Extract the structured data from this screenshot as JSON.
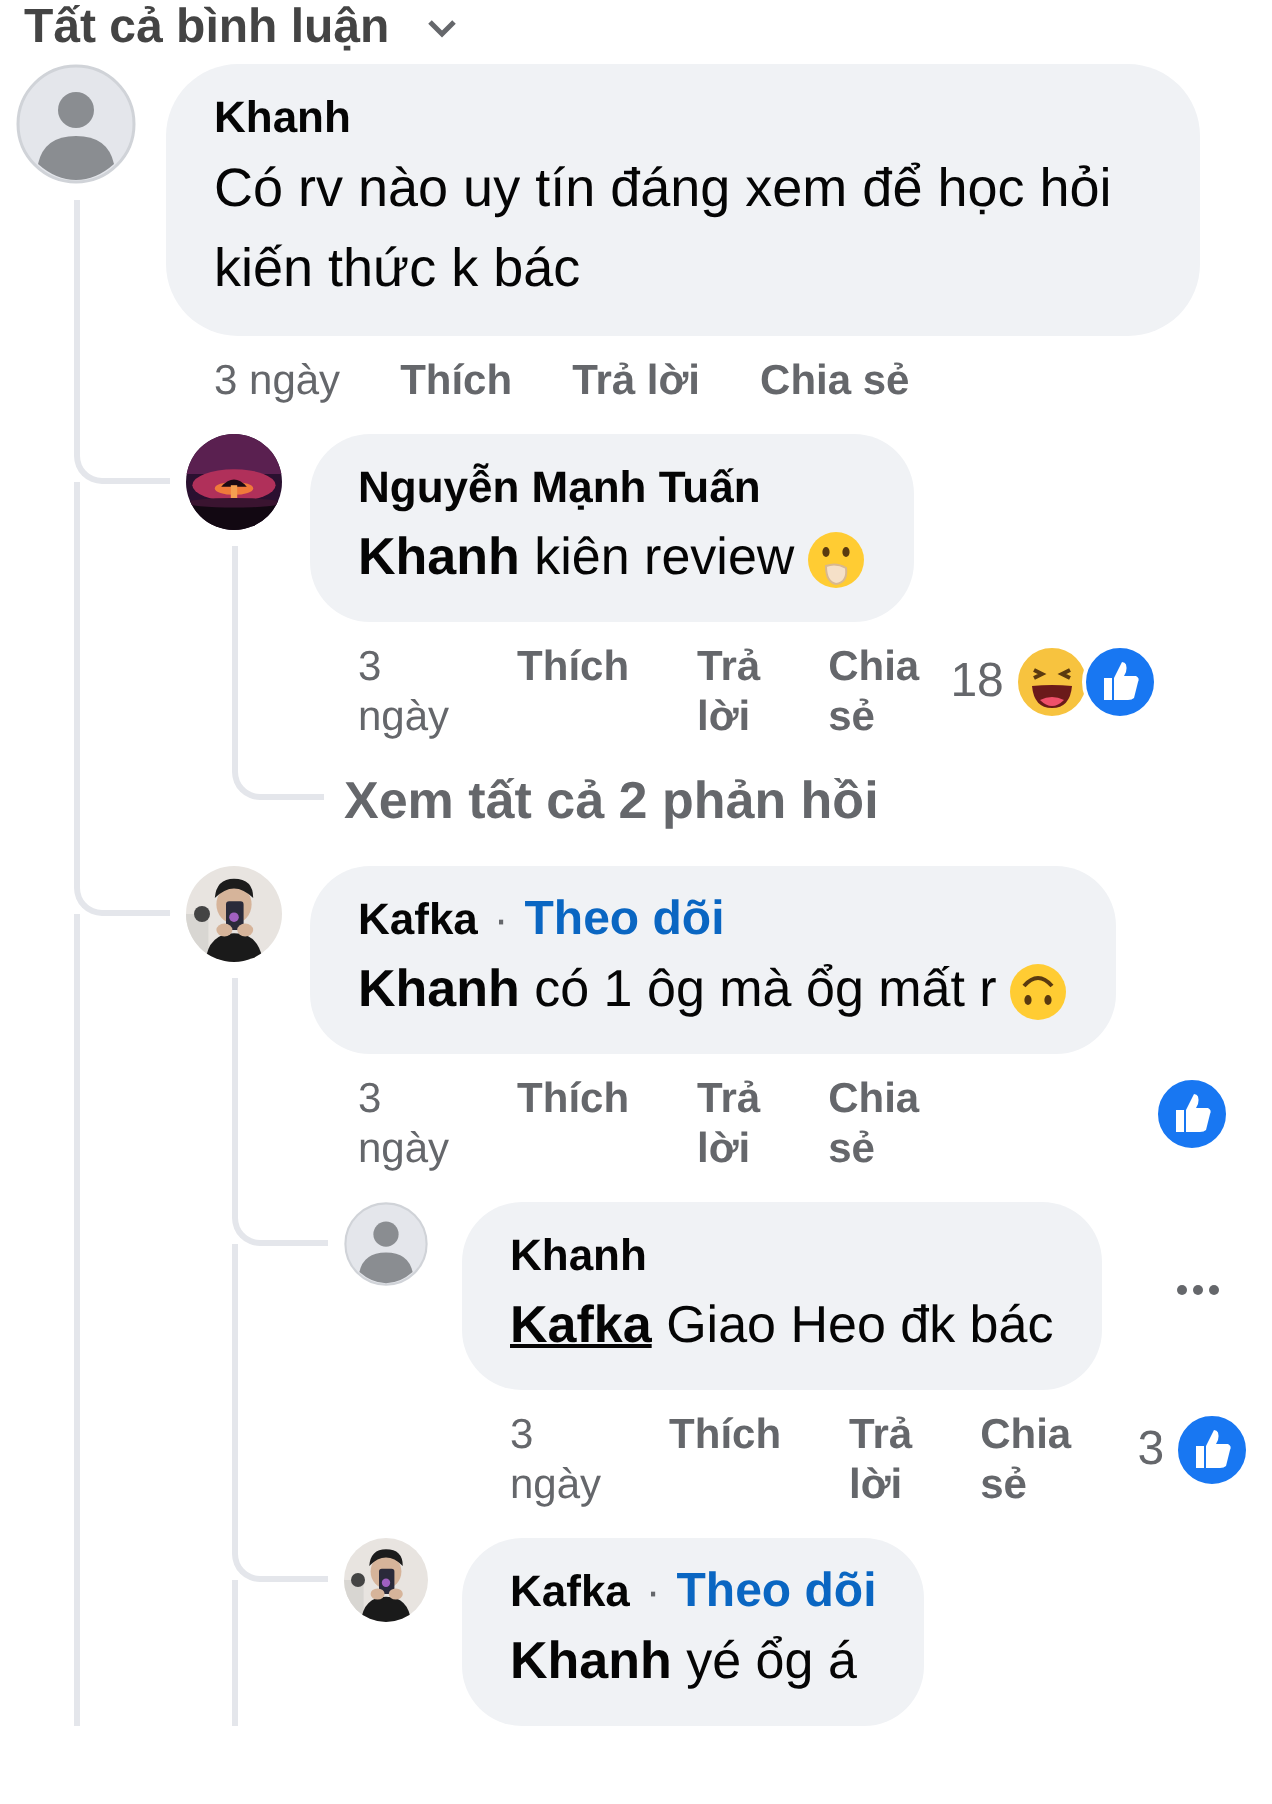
{
  "header": {
    "label": "Tất cả bình luận"
  },
  "comments": [
    {
      "kind": "comment",
      "author": "Khanh",
      "avatar": {
        "kind": "default"
      },
      "body": "Có rv nào uy tín đáng xem để học hỏi kiến thức k bác",
      "actions": [
        {
          "kind": "time",
          "label": "3 ngày"
        },
        {
          "kind": "like",
          "label": "Thích"
        },
        {
          "kind": "reply",
          "label": "Trả lời"
        },
        {
          "kind": "share",
          "label": "Chia sẻ"
        }
      ],
      "replies": [
        {
          "kind": "comment",
          "author": "Nguyễn Mạnh Tuấn",
          "avatar": {
            "kind": "picture"
          },
          "mention": {
            "text": "Khanh",
            "underlined": false
          },
          "body": "kiên review",
          "emoji": {
            "kind": "hand-over-mouth"
          },
          "actions": [
            {
              "kind": "time",
              "label": "3 ngày"
            },
            {
              "kind": "like",
              "label": "Thích"
            },
            {
              "kind": "reply",
              "label": "Trả lời"
            },
            {
              "kind": "share",
              "label": "Chia sẻ"
            }
          ],
          "reactions": {
            "count": "18",
            "icons": [
              {
                "kind": "haha"
              },
              {
                "kind": "like"
              }
            ]
          },
          "replies": [
            {
              "kind": "view_more",
              "label": "Xem tất cả 2 phản hồi"
            }
          ]
        },
        {
          "kind": "comment",
          "author": "Kafka",
          "separator": "·",
          "follow": "Theo dõi",
          "avatar": {
            "kind": "picture"
          },
          "mention": {
            "text": "Khanh",
            "underlined": false
          },
          "body": "có 1 ôg mà ổg mất r",
          "emoji": {
            "kind": "upside-down"
          },
          "actions": [
            {
              "kind": "time",
              "label": "3 ngày"
            },
            {
              "kind": "like",
              "label": "Thích"
            },
            {
              "kind": "reply",
              "label": "Trả lời"
            },
            {
              "kind": "share",
              "label": "Chia sẻ"
            }
          ],
          "reactions": {
            "icons": [
              {
                "kind": "like"
              }
            ]
          },
          "replies": [
            {
              "kind": "comment",
              "author": "Khanh",
              "avatar": {
                "kind": "default"
              },
              "mention": {
                "text": "Kafka",
                "underlined": true
              },
              "body": "Giao Heo đk bác",
              "more_menu": true,
              "actions": [
                {
                  "kind": "time",
                  "label": "3 ngày"
                },
                {
                  "kind": "like",
                  "label": "Thích"
                },
                {
                  "kind": "reply",
                  "label": "Trả lời"
                },
                {
                  "kind": "share",
                  "label": "Chia sẻ"
                }
              ],
              "reactions": {
                "count": "3",
                "icons": [
                  {
                    "kind": "like"
                  }
                ]
              }
            },
            {
              "kind": "comment",
              "author": "Kafka",
              "separator": "·",
              "follow": "Theo dõi",
              "avatar": {
                "kind": "picture"
              },
              "mention": {
                "text": "Khanh",
                "underlined": false
              },
              "body": "yé ổg á"
            }
          ]
        }
      ]
    }
  ]
}
